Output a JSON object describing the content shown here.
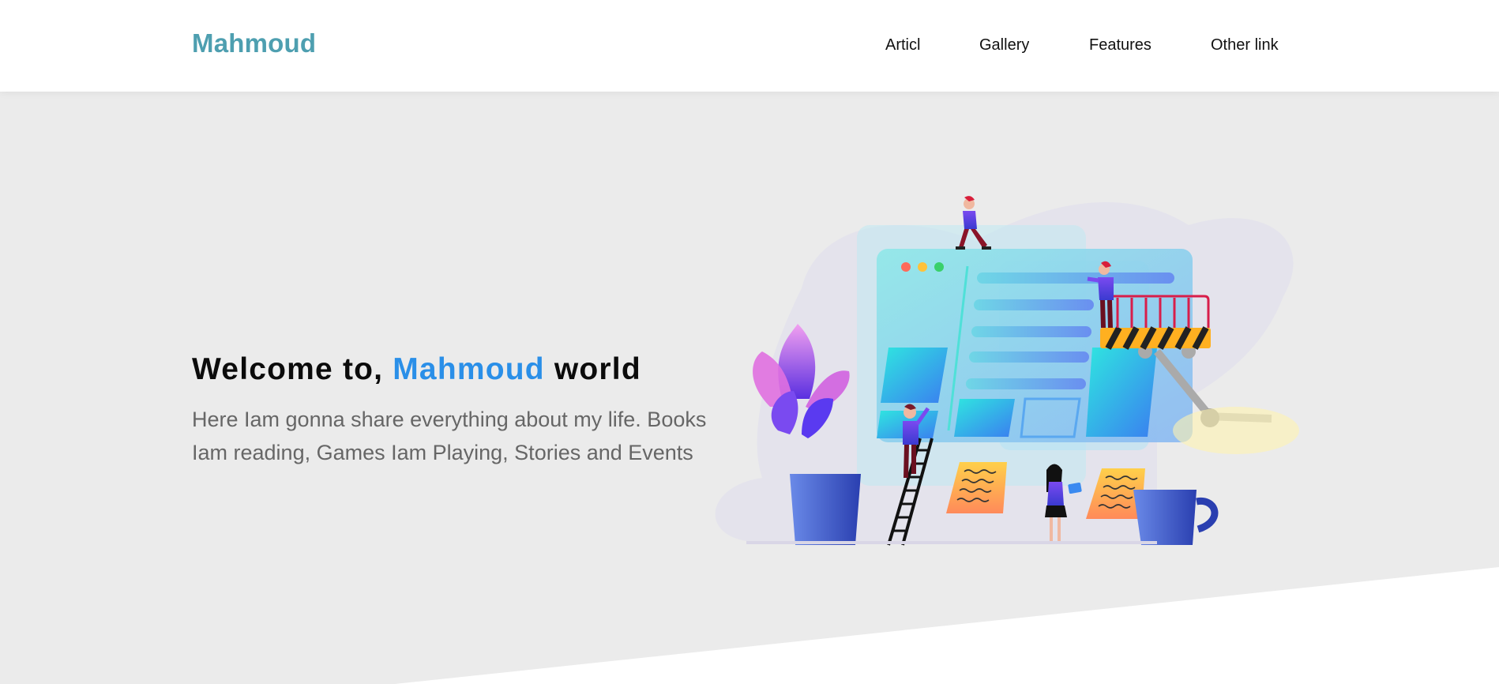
{
  "header": {
    "logo": "Mahmoud",
    "nav": [
      "Articl",
      "Gallery",
      "Features",
      "Other link"
    ]
  },
  "hero": {
    "title_prefix": "Welcome to,",
    "title_highlight": "Mahmoud",
    "title_suffix": "world",
    "description": "Here Iam gonna share everything about my life. Books Iam reading, Games Iam Playing, Stories and Events"
  },
  "colors": {
    "logo": "#4e9fb0",
    "highlight": "#2a8fe8",
    "background": "#ebebeb",
    "header_bg": "#ffffff"
  }
}
